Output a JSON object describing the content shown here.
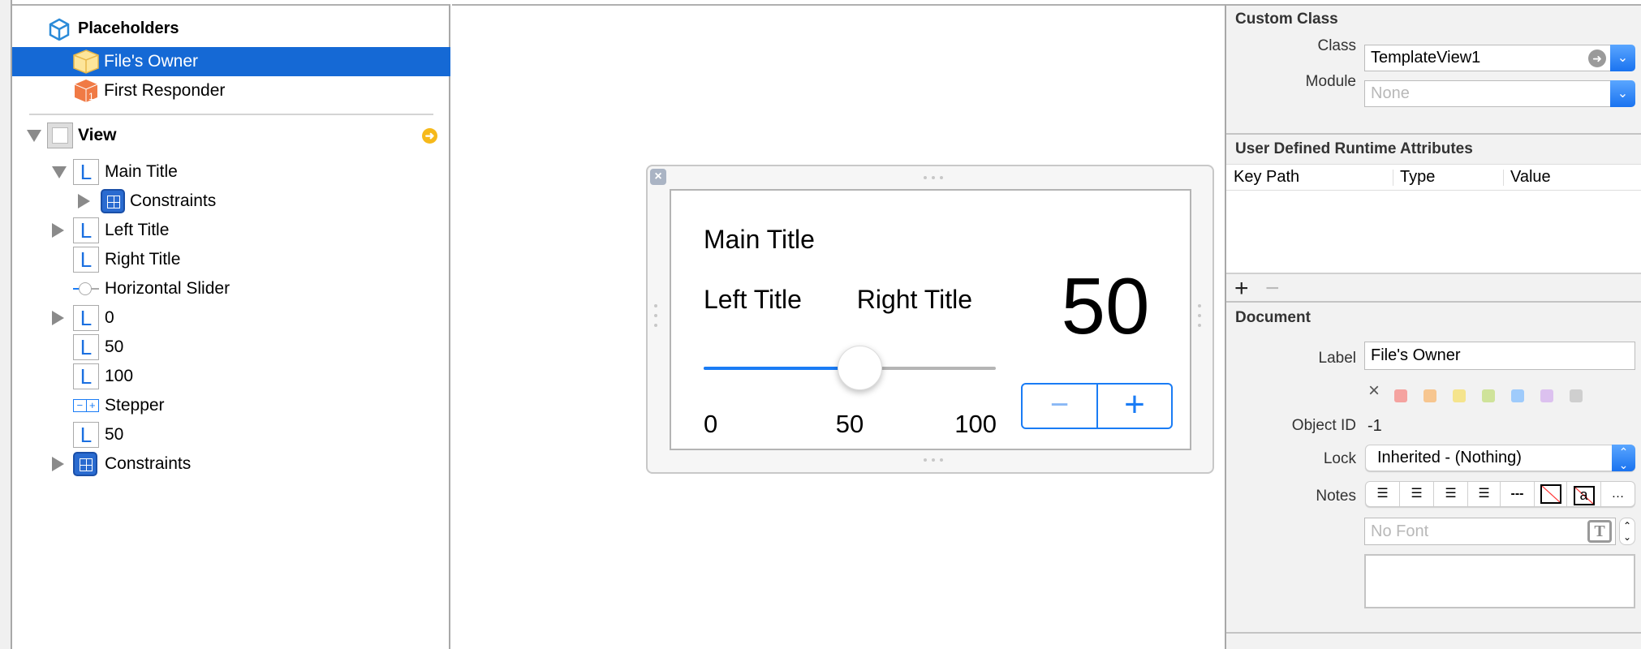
{
  "outline": {
    "placeholders_label": "Placeholders",
    "items": [
      {
        "label": "File's Owner",
        "icon": "files-owner-cube-icon",
        "selected": true
      },
      {
        "label": "First Responder",
        "icon": "first-responder-cube-icon"
      }
    ],
    "view": {
      "label": "View",
      "children": [
        {
          "label": "Main Title",
          "icon": "label-icon",
          "disclosure": "expanded"
        },
        {
          "label": "Constraints",
          "icon": "constraints-icon",
          "disclosure": "collapsed"
        },
        {
          "label": "Left Title",
          "icon": "label-icon",
          "disclosure": "collapsed"
        },
        {
          "label": "Right Title",
          "icon": "label-icon"
        },
        {
          "label": "Horizontal Slider",
          "icon": "slider-icon"
        },
        {
          "label": "0",
          "icon": "label-icon",
          "disclosure": "collapsed"
        },
        {
          "label": "50",
          "icon": "label-icon"
        },
        {
          "label": "100",
          "icon": "label-icon"
        },
        {
          "label": "Stepper",
          "icon": "stepper-icon"
        },
        {
          "label": "50",
          "icon": "label-icon"
        },
        {
          "label": "Constraints",
          "icon": "constraints-icon",
          "disclosure": "collapsed"
        }
      ]
    }
  },
  "canvas": {
    "main_title": "Main Title",
    "left_title": "Left Title",
    "right_title": "Right Title",
    "value_display": "50",
    "slider": {
      "min_label": "0",
      "mid_label": "50",
      "max_label": "100",
      "value_fraction": 0.5
    },
    "stepper": {
      "minus": "−",
      "plus": "+"
    },
    "accent": "#1a7cf5"
  },
  "inspector": {
    "custom_class": {
      "header": "Custom Class",
      "class_label": "Class",
      "class_value": "TemplateView1",
      "module_label": "Module",
      "module_placeholder": "None"
    },
    "runtime_attributes": {
      "header": "User Defined Runtime Attributes",
      "columns": [
        "Key Path",
        "Type",
        "Value"
      ],
      "add": "+",
      "remove": "−"
    },
    "document": {
      "header": "Document",
      "label_label": "Label",
      "label_value": "File's Owner",
      "label_colors": [
        "#f5a3a0",
        "#f7c690",
        "#f5e48d",
        "#cfe39a",
        "#9fcbfb",
        "#dcc1ef",
        "#cfcfcf"
      ],
      "clear_color": "×",
      "object_id_label": "Object ID",
      "object_id_value": "-1",
      "lock_label": "Lock",
      "lock_value": "Inherited - (Nothing)",
      "notes_label": "Notes",
      "font_placeholder": "No Font",
      "more": "…"
    }
  }
}
